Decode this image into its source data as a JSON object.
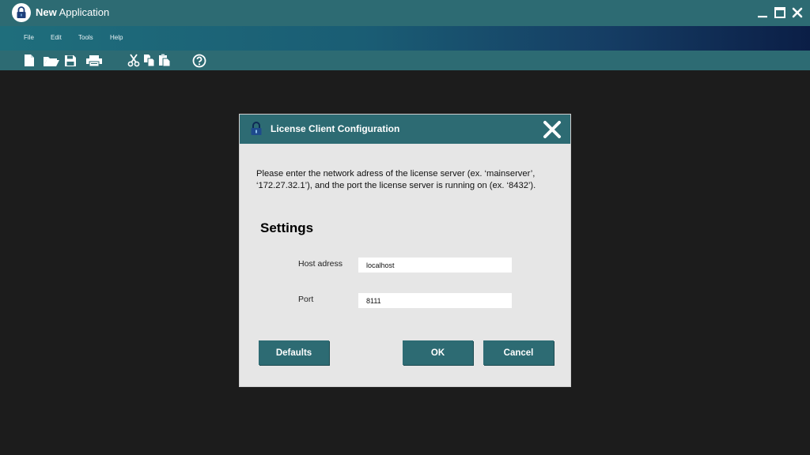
{
  "window": {
    "title_bold": "New",
    "title_rest": " Application"
  },
  "menu": {
    "items": [
      {
        "label": "File"
      },
      {
        "label": "Edit"
      },
      {
        "label": "Tools"
      },
      {
        "label": "Help"
      }
    ]
  },
  "toolbar": {
    "icons": [
      "new-file-icon",
      "open-folder-icon",
      "save-icon",
      "print-icon",
      "cut-icon",
      "copy-icon",
      "paste-icon",
      "help-icon"
    ]
  },
  "dialog": {
    "title": "License Client Configuration",
    "description": "Please enter the network adress of the license server (ex. ‘mainserver’, ‘172.27.32.1’), and the port the license server is running on (ex. ‘8432’).",
    "section_title": "Settings",
    "host_label": "Host adress",
    "host_value": "localhost",
    "port_label": "Port",
    "port_value": "8111",
    "buttons": {
      "defaults": "Defaults",
      "ok": "OK",
      "cancel": "Cancel"
    }
  },
  "colors": {
    "accent": "#2d6b73",
    "background": "#1c1c1c",
    "dialog_bg": "#e6e6e6"
  }
}
